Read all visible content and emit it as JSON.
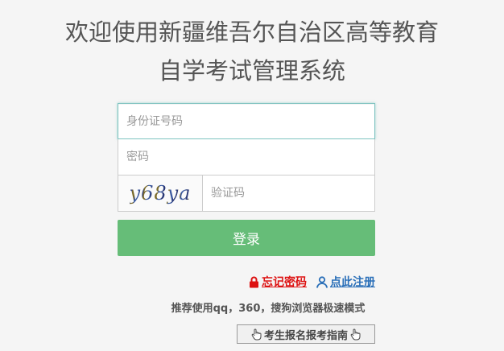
{
  "header": {
    "title_line1": "欢迎使用新疆维吾尔自治区高等教育",
    "title_line2": "自学考试管理系统"
  },
  "login_form": {
    "id_number_placeholder": "身份证号码",
    "password_placeholder": "密码",
    "captcha_image_text": "y68ya",
    "captcha_placeholder": "验证码",
    "login_button_label": "登录"
  },
  "links": {
    "forgot_password_label": "忘记密码",
    "register_label": "点此注册"
  },
  "notice": {
    "browser_recommendation": "推荐使用qq，360，搜狗浏览器极速模式"
  },
  "guide": {
    "label": "考生报名报考指南"
  },
  "icons": {
    "forgot_password_icon": "lock-icon",
    "register_icon": "user-icon",
    "guide_left_icon": "hand-pointer-icon",
    "guide_right_icon": "hand-pointer-icon"
  },
  "colors": {
    "background": "#f5f5f5",
    "title_text": "#555555",
    "login_button": "#66bd78",
    "forgot_password": "#dd1111",
    "register_link": "#2a6fb8"
  }
}
